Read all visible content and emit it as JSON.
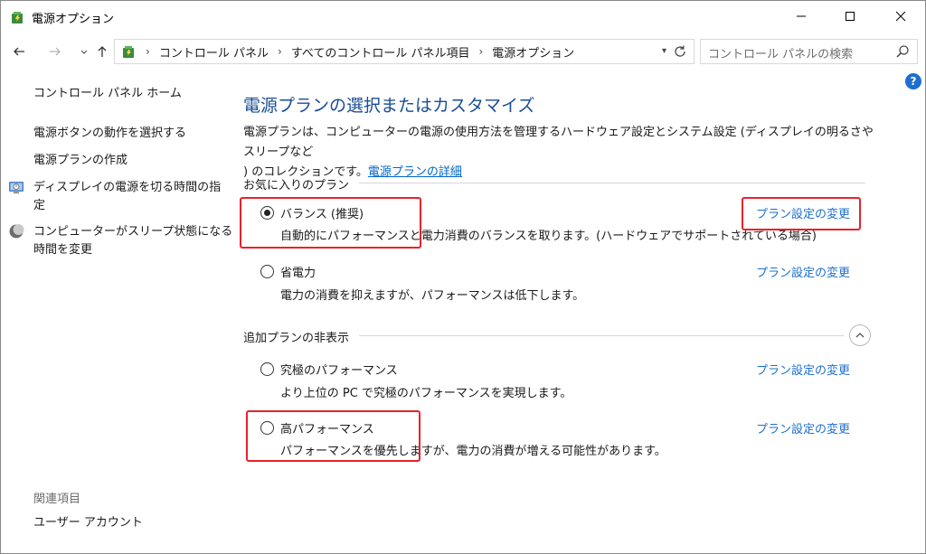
{
  "window": {
    "title": "電源オプション"
  },
  "nav": {
    "breadcrumb": [
      "コントロール パネル",
      "すべてのコントロール パネル項目",
      "電源オプション"
    ],
    "search_placeholder": "コントロール パネルの検索"
  },
  "sidebar": {
    "home": "コントロール パネル ホーム",
    "links": [
      "電源ボタンの動作を選択する",
      "電源プランの作成",
      "ディスプレイの電源を切る時間の指定",
      "コンピューターがスリープ状態になる時間を変更"
    ],
    "link3_lines": [
      "ディスプレイの電源を切る時間の指",
      "定"
    ],
    "link4_lines": [
      "コンピューターがスリープ状態になる",
      "時間を変更"
    ],
    "related_title": "関連項目",
    "related_links": [
      "ユーザー アカウント"
    ]
  },
  "main": {
    "title": "電源プランの選択またはカスタマイズ",
    "desc_line1": "電源プランは、コンピューターの電源の使用方法を管理するハードウェア設定とシステム設定 (ディスプレイの明るさやスリープなど",
    "desc_line2_prefix": ") のコレクションです。",
    "desc_link": "電源プランの詳細",
    "favorites_label": "お気に入りのプラン",
    "hidden_label": "追加プランの非表示",
    "change_link": "プラン設定の変更",
    "plans": [
      {
        "name": "バランス (推奨)",
        "desc": "自動的にパフォーマンスと電力消費のバランスを取ります。(ハードウェアでサポートされている場合)",
        "selected": true
      },
      {
        "name": "省電力",
        "desc": "電力の消費を抑えますが、パフォーマンスは低下します。",
        "selected": false
      },
      {
        "name": "究極のパフォーマンス",
        "desc": "より上位の PC で究極のパフォーマンスを実現します。",
        "selected": false
      },
      {
        "name": "高パフォーマンス",
        "desc": "パフォーマンスを優先しますが、電力の消費が増える可能性があります。",
        "selected": false
      }
    ]
  },
  "help": {
    "label": "?"
  },
  "colors": {
    "accent": "#1e6fd0",
    "title": "#1a4e96",
    "highlight": "#e8222b"
  }
}
